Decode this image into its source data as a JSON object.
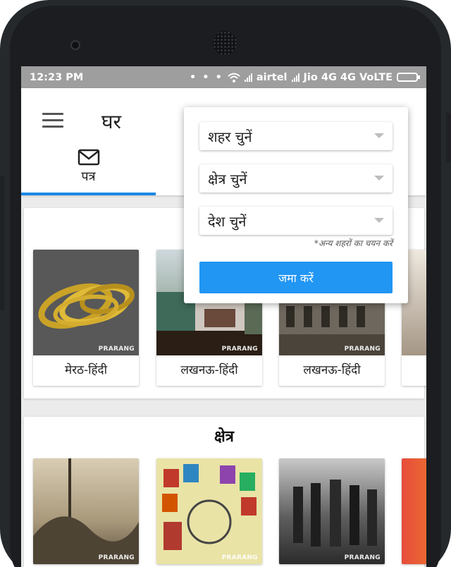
{
  "status_bar": {
    "time": "12:23 PM",
    "carrier1": "airtel",
    "carrier2": "Jio 4G 4G VoLTE"
  },
  "app_bar": {
    "title": "घर",
    "menu_icon": "hamburger-menu-icon"
  },
  "tabs": [
    {
      "label": "पत्र",
      "icon": "mail-icon",
      "selected": true
    }
  ],
  "accent_color": "#1e88e5",
  "sections": [
    {
      "title": "",
      "cards": [
        {
          "caption": "मेरठ-हिंदी",
          "watermark": "PRARANG"
        },
        {
          "caption": "लखनऊ-हिंदी",
          "watermark": "PRARANG"
        },
        {
          "caption": "लखनऊ-हिंदी",
          "watermark": "PRARANG"
        }
      ]
    },
    {
      "title": "क्षेत्र",
      "cards": [
        {
          "caption": "",
          "watermark": "PRARANG"
        },
        {
          "caption": "",
          "watermark": "PRARANG"
        },
        {
          "caption": "",
          "watermark": "PRARANG"
        }
      ]
    }
  ],
  "popup": {
    "city_select": "शहर चुनें",
    "region_select": "क्षेत्र चुनें",
    "country_select": "देश चुनें",
    "hint": "*अन्य शहरों का चयन करें",
    "submit_label": "जमा करें",
    "submit_color": "#2196f3"
  }
}
